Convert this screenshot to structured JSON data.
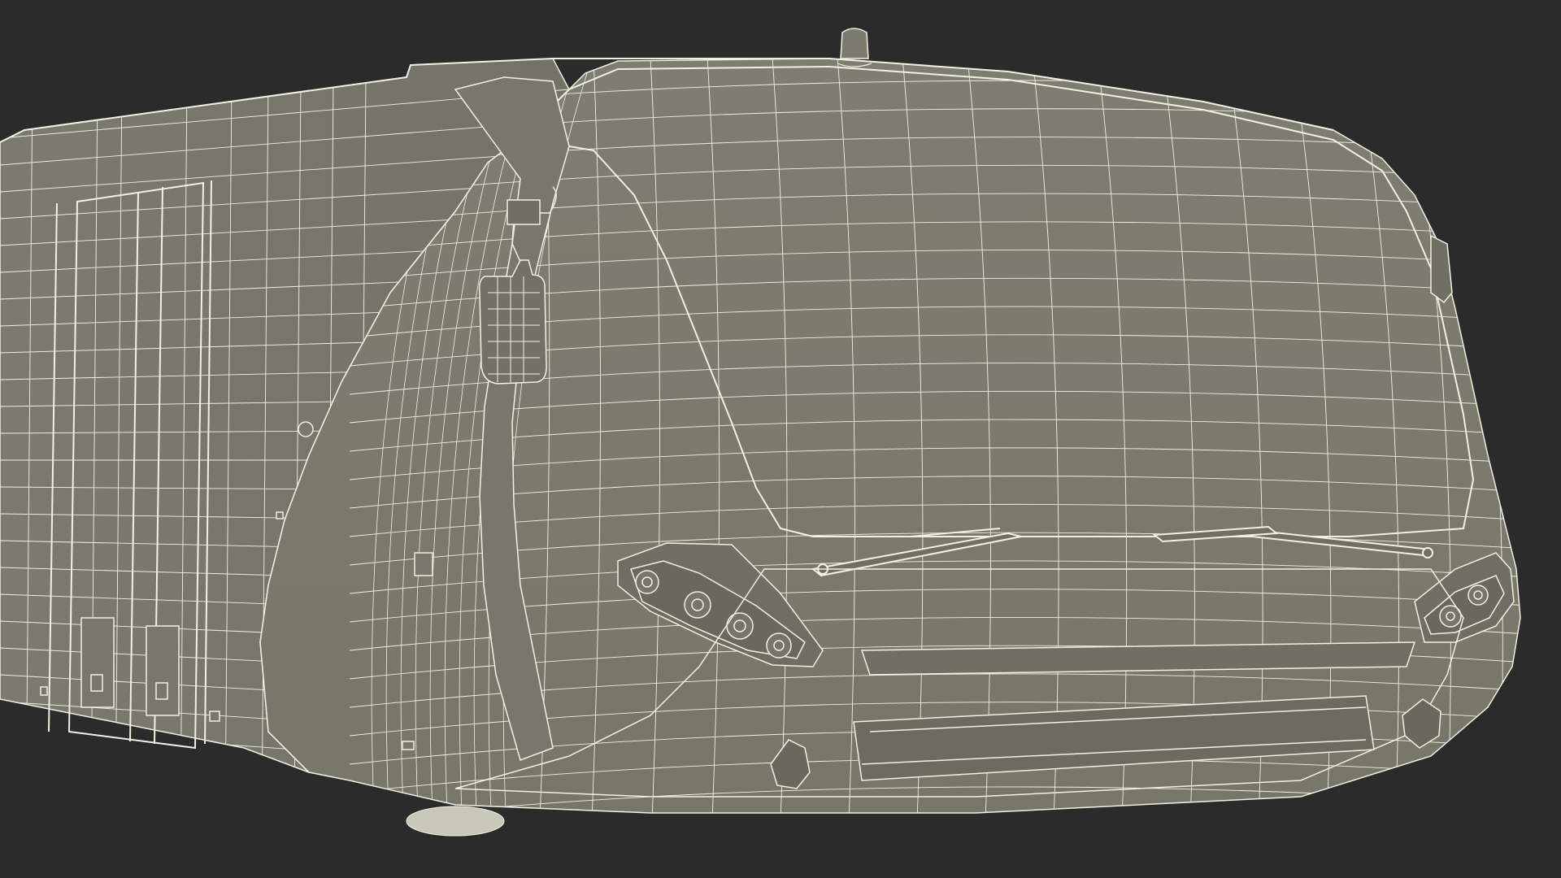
{
  "scene": {
    "subject": "bus-wireframe-3d-render",
    "background_color": "#2b2b2b",
    "surface_color": "#7b7b6f",
    "surface_dark_color": "#6e6e63",
    "wire_color": "#f1f1e2",
    "shadow_color": "#55554c"
  }
}
